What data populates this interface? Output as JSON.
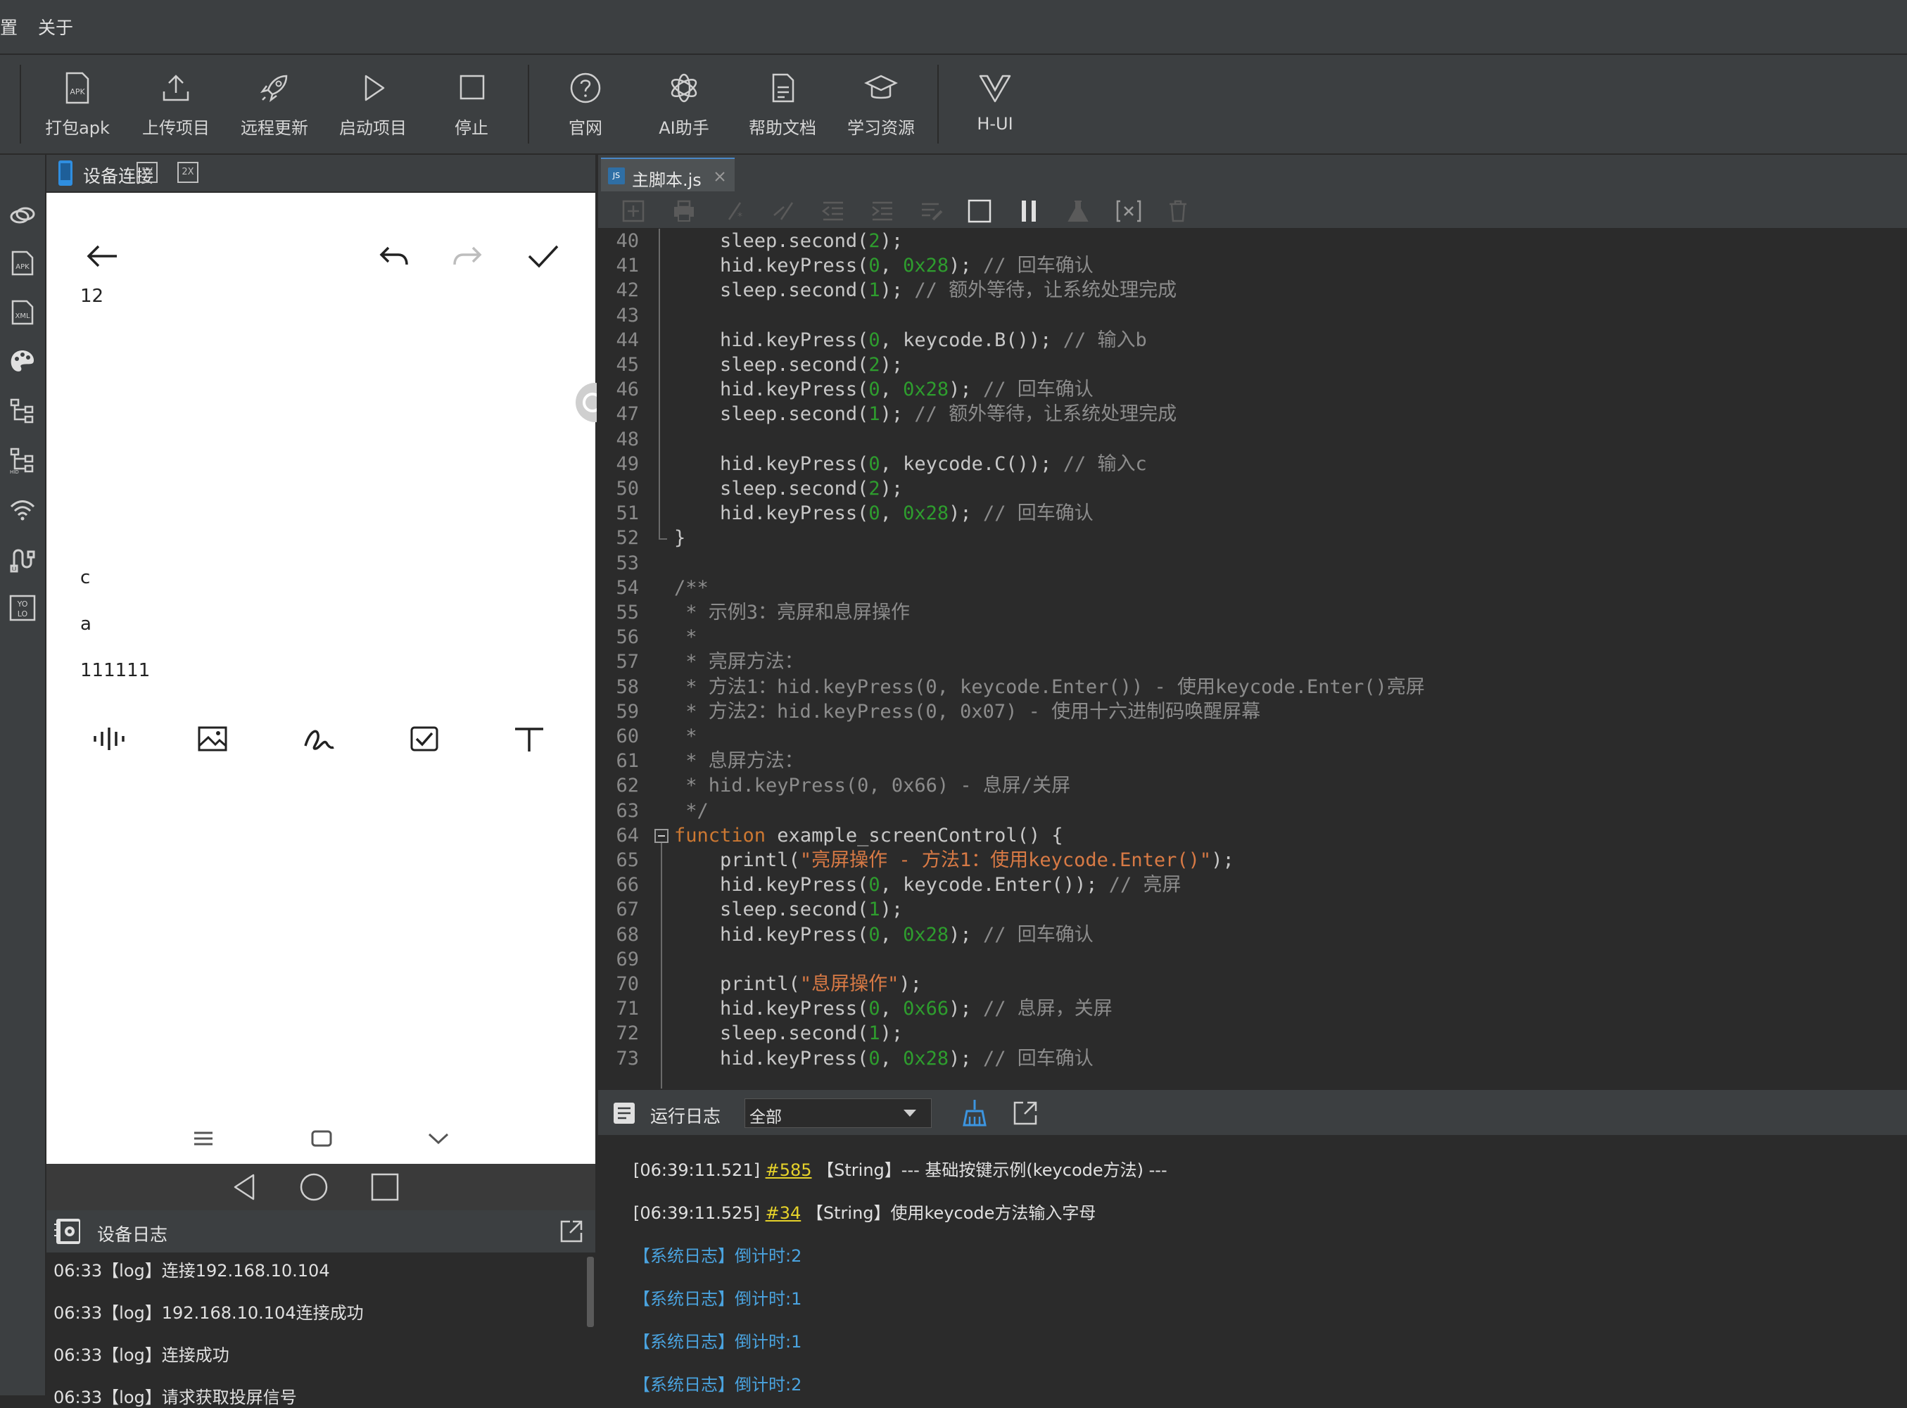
{
  "menu": {
    "items": [
      "置",
      "关于"
    ]
  },
  "toolbar": {
    "buttons": [
      {
        "label": "打包apk",
        "icon": "apk-icon"
      },
      {
        "label": "上传项目",
        "icon": "upload-icon"
      },
      {
        "label": "远程更新",
        "icon": "rocket-icon"
      },
      {
        "label": "启动项目",
        "icon": "play-icon"
      },
      {
        "label": "停止",
        "icon": "stop-icon"
      },
      {
        "label": "官网",
        "icon": "help-circle-icon"
      },
      {
        "label": "AI助手",
        "icon": "ai-icon"
      },
      {
        "label": "帮助文档",
        "icon": "document-icon"
      },
      {
        "label": "学习资源",
        "icon": "graduation-cap-icon"
      },
      {
        "label": "H-UI",
        "icon": "vue-icon"
      }
    ]
  },
  "device_panel": {
    "title": "设备连接",
    "zoom_1x": "1X",
    "zoom_2x": "2X"
  },
  "phone_screen": {
    "number_text": "12",
    "lines": [
      "c",
      "a",
      "111111"
    ]
  },
  "device_log": {
    "title": "设备日志",
    "lines": [
      "06:33【log】连接192.168.10.104",
      "06:33【log】192.168.10.104连接成功",
      "06:33【log】连接成功",
      "06:33【log】请求获取投屏信号"
    ]
  },
  "editor": {
    "tab_label": "主脚本.js",
    "tab_badge": "JS"
  },
  "code": [
    {
      "n": "40",
      "t": "    sleep.second(2);"
    },
    {
      "n": "41",
      "t": "    hid.keyPress(0, 0x28); // 回车确认"
    },
    {
      "n": "42",
      "t": "    sleep.second(1); // 额外等待，让系统处理完成"
    },
    {
      "n": "43",
      "t": ""
    },
    {
      "n": "44",
      "t": "    hid.keyPress(0, keycode.B()); // 输入b"
    },
    {
      "n": "45",
      "t": "    sleep.second(2);"
    },
    {
      "n": "46",
      "t": "    hid.keyPress(0, 0x28); // 回车确认"
    },
    {
      "n": "47",
      "t": "    sleep.second(1); // 额外等待，让系统处理完成"
    },
    {
      "n": "48",
      "t": ""
    },
    {
      "n": "49",
      "t": "    hid.keyPress(0, keycode.C()); // 输入c"
    },
    {
      "n": "50",
      "t": "    sleep.second(2);"
    },
    {
      "n": "51",
      "t": "    hid.keyPress(0, 0x28); // 回车确认"
    },
    {
      "n": "52",
      "t": "}"
    },
    {
      "n": "53",
      "t": ""
    },
    {
      "n": "54",
      "t": "/**"
    },
    {
      "n": "55",
      "t": " * 示例3：亮屏和息屏操作"
    },
    {
      "n": "56",
      "t": " *"
    },
    {
      "n": "57",
      "t": " * 亮屏方法："
    },
    {
      "n": "58",
      "t": " * 方法1：hid.keyPress(0, keycode.Enter()) - 使用keycode.Enter()亮屏"
    },
    {
      "n": "59",
      "t": " * 方法2：hid.keyPress(0, 0x07) - 使用十六进制码唤醒屏幕"
    },
    {
      "n": "60",
      "t": " *"
    },
    {
      "n": "61",
      "t": " * 息屏方法："
    },
    {
      "n": "62",
      "t": " * hid.keyPress(0, 0x66) - 息屏/关屏"
    },
    {
      "n": "63",
      "t": " */"
    },
    {
      "n": "64",
      "t": "function example_screenControl() {"
    },
    {
      "n": "65",
      "t": "    printl(\"亮屏操作 - 方法1：使用keycode.Enter()\");"
    },
    {
      "n": "66",
      "t": "    hid.keyPress(0, keycode.Enter()); // 亮屏"
    },
    {
      "n": "67",
      "t": "    sleep.second(1);"
    },
    {
      "n": "68",
      "t": "    hid.keyPress(0, 0x28); // 回车确认"
    },
    {
      "n": "69",
      "t": ""
    },
    {
      "n": "70",
      "t": "    printl(\"息屏操作\");"
    },
    {
      "n": "71",
      "t": "    hid.keyPress(0, 0x66); // 息屏，关屏"
    },
    {
      "n": "72",
      "t": "    sleep.second(1);"
    },
    {
      "n": "73",
      "t": "    hid.keyPress(0, 0x28); // 回车确认"
    }
  ],
  "run_log": {
    "title": "运行日志",
    "filter_value": "全部",
    "lines": [
      {
        "kind": "user",
        "time": "[06:39:11.521]",
        "ref": "#585",
        "text": "【String】--- 基础按键示例(keycode方法) ---"
      },
      {
        "kind": "user",
        "time": "[06:39:11.525]",
        "ref": "#34",
        "text": "【String】使用keycode方法输入字母"
      },
      {
        "kind": "sys",
        "text": "【系统日志】倒计时:2"
      },
      {
        "kind": "sys",
        "text": "【系统日志】倒计时:1"
      },
      {
        "kind": "sys",
        "text": "【系统日志】倒计时:1"
      },
      {
        "kind": "sys",
        "text": "【系统日志】倒计时:2"
      }
    ]
  },
  "colors": {
    "accent_blue": "#4aa3df",
    "link_yellow": "#e6d22a",
    "number_green": "#2e9d2e",
    "string_orange": "#d87a45",
    "keyword_orange": "#cc7832"
  }
}
